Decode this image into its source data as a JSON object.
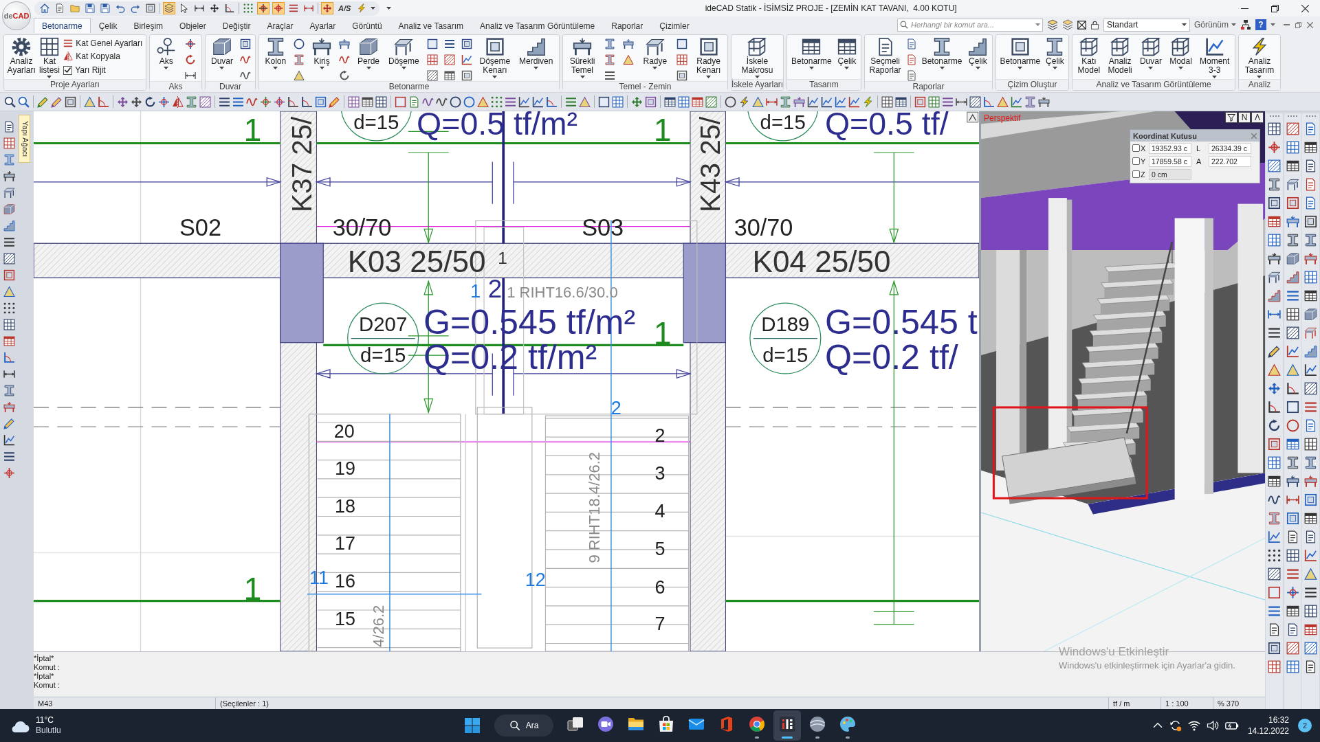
{
  "title_bar": {
    "app_logo": [
      "de",
      "CAD"
    ],
    "quick_access": [
      {
        "on": false
      },
      {
        "on": false
      },
      {
        "on": false
      },
      {
        "on": false
      },
      {
        "on": false
      },
      {
        "on": false
      },
      {
        "on": false
      },
      {
        "on": false
      },
      {
        "on": true
      },
      {
        "on": false
      },
      {
        "on": false
      },
      {
        "on": false
      },
      {
        "on": false
      },
      {
        "on": false
      },
      {
        "on": true
      },
      {
        "on": true
      },
      {
        "on": false
      },
      {
        "on": false
      },
      {
        "on": true
      },
      {
        "on": false,
        "label": "A/S"
      },
      {
        "on": false
      }
    ],
    "title": "ideCAD Statik - İSİMSİZ PROJE - [ZEMİN KAT TAVANI,  4.00 KOTU]"
  },
  "ribbon": {
    "tabs": [
      {
        "label": "Betonarme",
        "selected": true
      },
      {
        "label": "Çelik",
        "selected": false
      },
      {
        "label": "Birleşim",
        "selected": false
      },
      {
        "label": "Objeler",
        "selected": false
      },
      {
        "label": "Değiştir",
        "selected": false
      },
      {
        "label": "Araçlar",
        "selected": false
      },
      {
        "label": "Ayarlar",
        "selected": false
      },
      {
        "label": "Görüntü",
        "selected": false
      },
      {
        "label": "Analiz ve Tasarım",
        "selected": false
      },
      {
        "label": "Analiz ve Tasarım Görüntüleme",
        "selected": false
      },
      {
        "label": "Raporlar",
        "selected": false
      },
      {
        "label": "Çizimler",
        "selected": false
      }
    ],
    "search": {
      "placeholder": "Herhangi bir komut ara..."
    },
    "view_style": "Standart",
    "view_menu": "Görünüm",
    "help": "?",
    "groups": [
      {
        "title": "Proje Ayarları",
        "items": [
          {
            "kind": "large",
            "label": "Analiz Ayarları",
            "dropdown": false
          },
          {
            "kind": "large",
            "label": "Kat listesi",
            "dropdown": true
          },
          {
            "kind": "list",
            "entries": [
              {
                "kind": "button",
                "label": "Kat Genel Ayarları"
              },
              {
                "kind": "button",
                "label": "Kat Kopyala"
              },
              {
                "kind": "checkbox",
                "label": "Yarı Rijit",
                "checked": true
              }
            ]
          }
        ]
      },
      {
        "title": "Aks",
        "items": [
          {
            "kind": "large",
            "label": "Aks",
            "dropdown": true
          },
          {
            "kind": "icons"
          }
        ]
      },
      {
        "title": "Duvar",
        "items": [
          {
            "kind": "large",
            "label": "Duvar",
            "dropdown": true
          },
          {
            "kind": "icons"
          }
        ]
      },
      {
        "title": "Betonarme",
        "items": [
          {
            "kind": "large",
            "label": "Kolon",
            "dropdown": true
          },
          {
            "kind": "icons"
          },
          {
            "kind": "large",
            "label": "Kiriş",
            "dropdown": true
          },
          {
            "kind": "icons"
          },
          {
            "kind": "large",
            "label": "Perde",
            "dropdown": true
          },
          {
            "kind": "large",
            "label": "Döşeme",
            "dropdown": true
          },
          {
            "kind": "icons"
          },
          {
            "kind": "icons"
          },
          {
            "kind": "icons"
          },
          {
            "kind": "large",
            "label": "Döşeme Kenarı",
            "dropdown": true
          },
          {
            "kind": "large",
            "label": "Merdiven",
            "dropdown": true
          }
        ]
      },
      {
        "title": "Temel - Zemin",
        "items": [
          {
            "kind": "large",
            "label": "Sürekli Temel",
            "dropdown": true
          },
          {
            "kind": "icons"
          },
          {
            "kind": "icons"
          },
          {
            "kind": "large",
            "label": "Radye",
            "dropdown": true
          },
          {
            "kind": "icons"
          },
          {
            "kind": "large",
            "label": "Radye Kenarı",
            "dropdown": true
          }
        ]
      },
      {
        "title": "İskele Ayarları",
        "items": [
          {
            "kind": "large",
            "label": "İskele Makrosu",
            "dropdown": true
          }
        ]
      },
      {
        "title": "Tasarım",
        "items": [
          {
            "kind": "large",
            "label": "Betonarme",
            "dropdown": true
          },
          {
            "kind": "large",
            "label": "Çelik",
            "dropdown": true
          }
        ]
      },
      {
        "title": "Raporlar",
        "items": [
          {
            "kind": "large",
            "label": "Seçmeli Raporlar",
            "dropdown": false
          },
          {
            "kind": "icons"
          },
          {
            "kind": "large",
            "label": "Betonarme",
            "dropdown": true
          },
          {
            "kind": "large",
            "label": "Çelik",
            "dropdown": true
          }
        ]
      },
      {
        "title": "Çizim Oluştur",
        "items": [
          {
            "kind": "large",
            "label": "Betonarme",
            "dropdown": true
          },
          {
            "kind": "large",
            "label": "Çelik",
            "dropdown": true
          }
        ]
      },
      {
        "title": "Analiz ve Tasarım Görüntüleme",
        "items": [
          {
            "kind": "large",
            "label": "Katı Model",
            "dropdown": false
          },
          {
            "kind": "large",
            "label": "Analiz Modeli",
            "dropdown": false
          },
          {
            "kind": "large",
            "label": "Duvar",
            "dropdown": true
          },
          {
            "kind": "large",
            "label": "Modal",
            "dropdown": true
          },
          {
            "kind": "large",
            "label": "Moment 3-3",
            "dropdown": true
          }
        ]
      },
      {
        "title": "Analiz",
        "items": [
          {
            "kind": "large",
            "label": "Analiz Tasarım",
            "dropdown": true
          }
        ]
      }
    ]
  },
  "side_panel_tab": "Yapı Ağacı",
  "plan_view": {
    "labels": [
      {
        "text": "1",
        "kind": "axis_number"
      },
      {
        "text": "K37 25/",
        "kind": "column"
      },
      {
        "text": "Q=0.5 tf/m²",
        "kind": "load"
      },
      {
        "text": "1",
        "kind": "axis_number"
      },
      {
        "text": "K43 25/",
        "kind": "column"
      },
      {
        "text": "Q=0.5 tf/",
        "kind": "load"
      },
      {
        "text": "S02",
        "kind": "slab"
      },
      {
        "text": "30/70",
        "kind": "slab"
      },
      {
        "text": "S03",
        "kind": "slab"
      },
      {
        "text": "30/70",
        "kind": "slab"
      },
      {
        "text": "K03 25/50",
        "kind": "beam"
      },
      {
        "text": "1",
        "kind": "note"
      },
      {
        "text": "K04 25/50",
        "kind": "beam"
      },
      {
        "text": "1",
        "kind": "node"
      },
      {
        "text": "2",
        "kind": "node_large"
      },
      {
        "text": "1 RIHT16.6/30.0",
        "kind": "step"
      },
      {
        "text": "G=0.545 tf/m²",
        "kind": "load"
      },
      {
        "text": "1",
        "kind": "axis_number"
      },
      {
        "text": "G=0.545 t",
        "kind": "load"
      },
      {
        "text": "Q=0.2 tf/m²",
        "kind": "load"
      },
      {
        "text": "Q=0.2 tf/",
        "kind": "load"
      },
      {
        "text": "2",
        "kind": "node"
      },
      {
        "text": "20",
        "kind": "stair_number"
      },
      {
        "text": "2",
        "kind": "stair_number"
      },
      {
        "text": "19",
        "kind": "stair_number"
      },
      {
        "text": "3",
        "kind": "stair_number"
      },
      {
        "text": "18",
        "kind": "stair_number"
      },
      {
        "text": "4",
        "kind": "stair_number"
      },
      {
        "text": "17",
        "kind": "stair_number"
      },
      {
        "text": "5",
        "kind": "stair_number"
      },
      {
        "text": "9 RIHT18.4/26.2",
        "kind": "step_vertical"
      },
      {
        "text": "1",
        "kind": "axis_number"
      },
      {
        "text": "11",
        "kind": "node"
      },
      {
        "text": "16",
        "kind": "stair_number"
      },
      {
        "text": "12",
        "kind": "node"
      },
      {
        "text": "6",
        "kind": "stair_number"
      },
      {
        "text": "15",
        "kind": "stair_number"
      },
      {
        "text": "4/26.2",
        "kind": "step_vertical"
      },
      {
        "text": "7",
        "kind": "stair_number"
      }
    ],
    "slab_markers": [
      {
        "thickness": "d=15"
      },
      {
        "thickness": "d=15"
      },
      {
        "name": "D207",
        "thickness": "d=15"
      },
      {
        "name": "D189",
        "thickness": "d=15"
      }
    ]
  },
  "view_3d": {
    "title": "Perspektif",
    "view_buttons": [
      "N",
      "Λ"
    ],
    "coordinate_box": {
      "title": "Koordinat Kutusu",
      "rows": [
        {
          "label": "X",
          "checked": false,
          "value": "19352.93 c",
          "disabled": false,
          "readout": {
            "label": "L",
            "value": "26334.39 c"
          }
        },
        {
          "label": "Y",
          "checked": false,
          "value": "17859.58 c",
          "disabled": false,
          "readout": {
            "label": "A",
            "value": "222.702"
          }
        },
        {
          "label": "Z",
          "checked": false,
          "value": "0 cm",
          "disabled": true
        }
      ]
    }
  },
  "command_log": [
    "*İptal*",
    "Komut :",
    "*İptal*",
    "Komut :"
  ],
  "activation_notice": {
    "title": "Windows'u Etkinleştir",
    "text": "Windows'u etkinleştirmek için Ayarlar'a gidin."
  },
  "status_bar": {
    "left": [
      "M43",
      "(Seçilenler : 1)"
    ],
    "right": [
      "tf / m",
      "1 : 100",
      "% 370"
    ]
  },
  "taskbar": {
    "weather": {
      "temperature": "11°C",
      "condition": "Bulutlu"
    },
    "search": "Ara",
    "apps": [
      {
        "running": false,
        "active": false
      },
      {
        "running": false,
        "active": false
      },
      {
        "running": false,
        "active": false
      },
      {
        "running": false,
        "active": false
      },
      {
        "running": false,
        "active": false
      },
      {
        "running": false,
        "active": false
      },
      {
        "running": true,
        "active": false
      },
      {
        "running": true,
        "active": true
      },
      {
        "running": true,
        "active": false
      },
      {
        "running": true,
        "active": false
      }
    ],
    "clock": {
      "time": "16:32",
      "date": "14.12.2022"
    },
    "notifications": "2"
  }
}
